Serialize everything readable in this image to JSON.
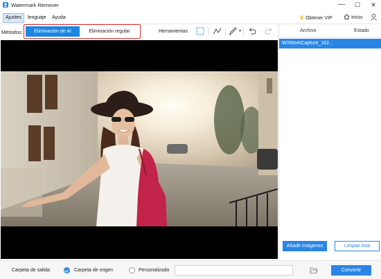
{
  "app": {
    "title": "Watermark Remover"
  },
  "window": {
    "minimize": "—",
    "maximize": "☐",
    "close": "✕"
  },
  "menu": {
    "items": [
      {
        "label": "Ajustes"
      },
      {
        "label": "lenguaje"
      },
      {
        "label": "Ayuda"
      }
    ],
    "vip_label": "Obtener VIP",
    "home_label": "Inicio"
  },
  "toolbar": {
    "methods_label": "Métodos:",
    "method_ai": "Eliminación de AI",
    "method_regular": "Eliminación regular",
    "tools_label": "Herramientas"
  },
  "file_list": {
    "col_file": "Archivo",
    "col_status": "Estado",
    "files": [
      {
        "name": "WXWorkCapture_162..."
      }
    ],
    "add_button": "Añadir imágenes",
    "clear_button": "Limpiar lista"
  },
  "output": {
    "label": "Carpeta de salida",
    "option_origin": "Carpeta de origen",
    "option_custom": "Personalizado",
    "path_value": "",
    "convert_button": "Convertir"
  },
  "colors": {
    "accent": "#2a86e6",
    "highlight_box": "#d93030",
    "vip": "#f2b400"
  }
}
